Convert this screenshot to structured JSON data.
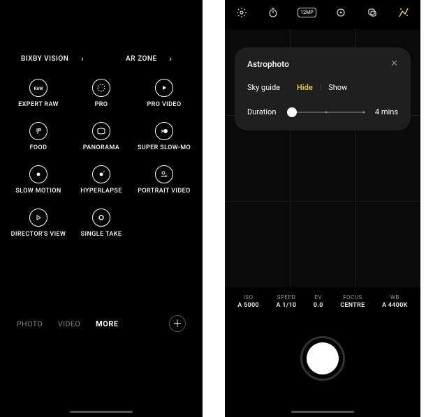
{
  "left": {
    "topLinks": {
      "bixby": "BIXBY VISION",
      "arzone": "AR ZONE"
    },
    "modes": {
      "expert_raw": "EXPERT RAW",
      "pro": "PRO",
      "pro_video": "PRO VIDEO",
      "food": "FOOD",
      "panorama": "PANORAMA",
      "super_slow_mo": "SUPER SLOW-MO",
      "slow_motion": "SLOW MOTION",
      "hyperlapse": "HYPERLAPSE",
      "portrait_video": "PORTRAIT VIDEO",
      "directors_view": "DIRECTOR'S VIEW",
      "single_take": "SINGLE TAKE"
    },
    "tabs": {
      "photo": "PHOTO",
      "video": "VIDEO",
      "more": "MORE"
    }
  },
  "right": {
    "topbar": {
      "res_badge": "12MP"
    },
    "panel": {
      "title": "Astrophoto",
      "skyguide_label": "Sky guide",
      "opt_hide": "Hide",
      "opt_show": "Show",
      "duration_label": "Duration",
      "duration_value": "4 mins"
    },
    "readout": {
      "iso_k": "ISO",
      "iso_v": "A 5000",
      "speed_k": "SPEED",
      "speed_v": "A 1/10",
      "ev_k": "EV",
      "ev_v": "0.0",
      "focus_k": "FOCUS",
      "focus_v": "CENTRE",
      "wb_k": "WB",
      "wb_v": "A 4400K"
    }
  }
}
